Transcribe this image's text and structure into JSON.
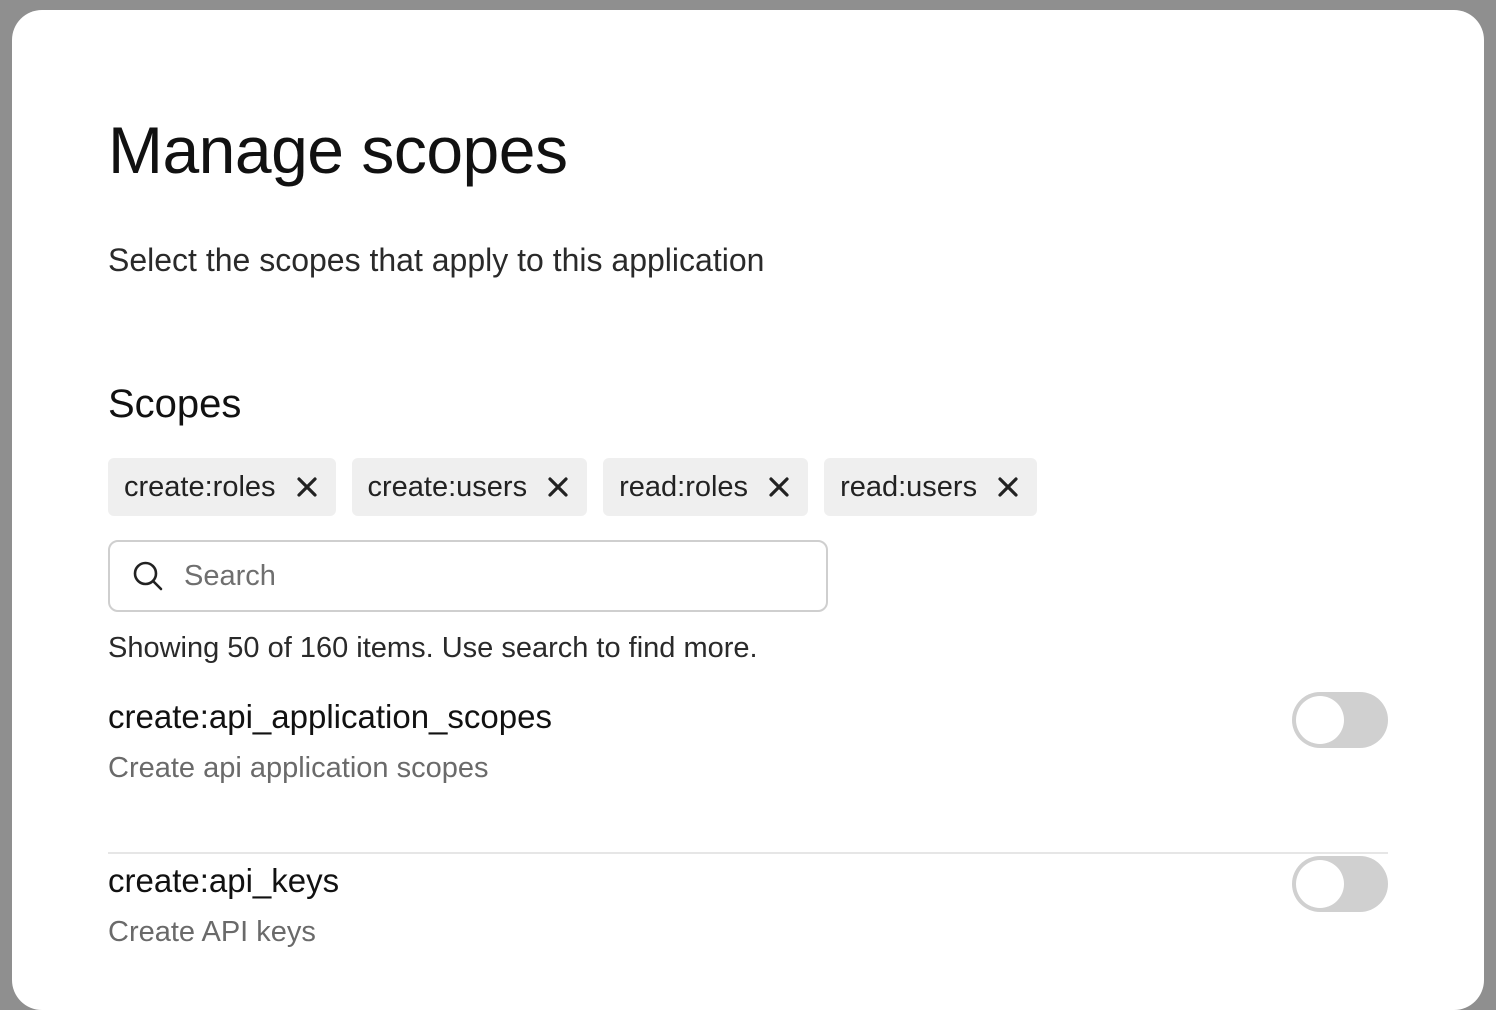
{
  "modal": {
    "title": "Manage scopes",
    "subtitle": "Select the scopes that apply to this application"
  },
  "scopes_section": {
    "heading": "Scopes",
    "selected": [
      {
        "label": "create:roles"
      },
      {
        "label": "create:users"
      },
      {
        "label": "read:roles"
      },
      {
        "label": "read:users"
      }
    ],
    "search": {
      "placeholder": "Search",
      "value": ""
    },
    "status_text": "Showing 50 of 160 items. Use search to find more.",
    "items": [
      {
        "name": "create:api_application_scopes",
        "description": "Create api application scopes",
        "enabled": false
      },
      {
        "name": "create:api_keys",
        "description": "Create API keys",
        "enabled": false
      }
    ]
  },
  "icons": {
    "chip_remove": "close-icon",
    "search": "search-icon"
  },
  "colors": {
    "chip_background": "#efefef",
    "toggle_off": "#d0d0d0"
  }
}
